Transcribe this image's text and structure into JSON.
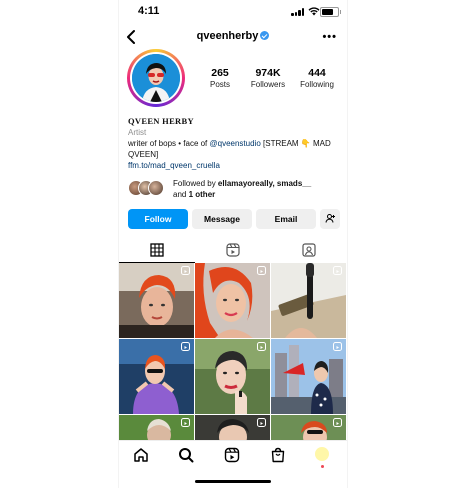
{
  "status_bar": {
    "time": "4:11"
  },
  "header": {
    "username": "qveenherby"
  },
  "profile": {
    "stats": [
      {
        "value": "265",
        "label": "Posts"
      },
      {
        "value": "974K",
        "label": "Followers"
      },
      {
        "value": "444",
        "label": "Following"
      }
    ],
    "name": "QVEEN HERBY",
    "category": "Artist",
    "bio_prefix": "writer of bops • face of ",
    "bio_mention": "@qveenstudio",
    "bio_suffix": " [STREAM 👇 MAD QVEEN]",
    "link": "ffm.to/mad_qveen_cruella",
    "followed_by_prefix": "Followed by ",
    "followed_by_names": "ellamayoreally, smads__",
    "followed_by_and": "and ",
    "followed_by_other": "1 other"
  },
  "buttons": {
    "follow": "Follow",
    "message": "Message",
    "email": "Email"
  },
  "tabs": [
    "grid-icon",
    "reels-icon",
    "tagged-icon"
  ],
  "nav": [
    "home-icon",
    "search-icon",
    "reels-icon",
    "shop-icon",
    "profile-avatar"
  ],
  "colors": {
    "accent": "#0095f6",
    "link": "#00376b",
    "verified": "#3897f0"
  }
}
